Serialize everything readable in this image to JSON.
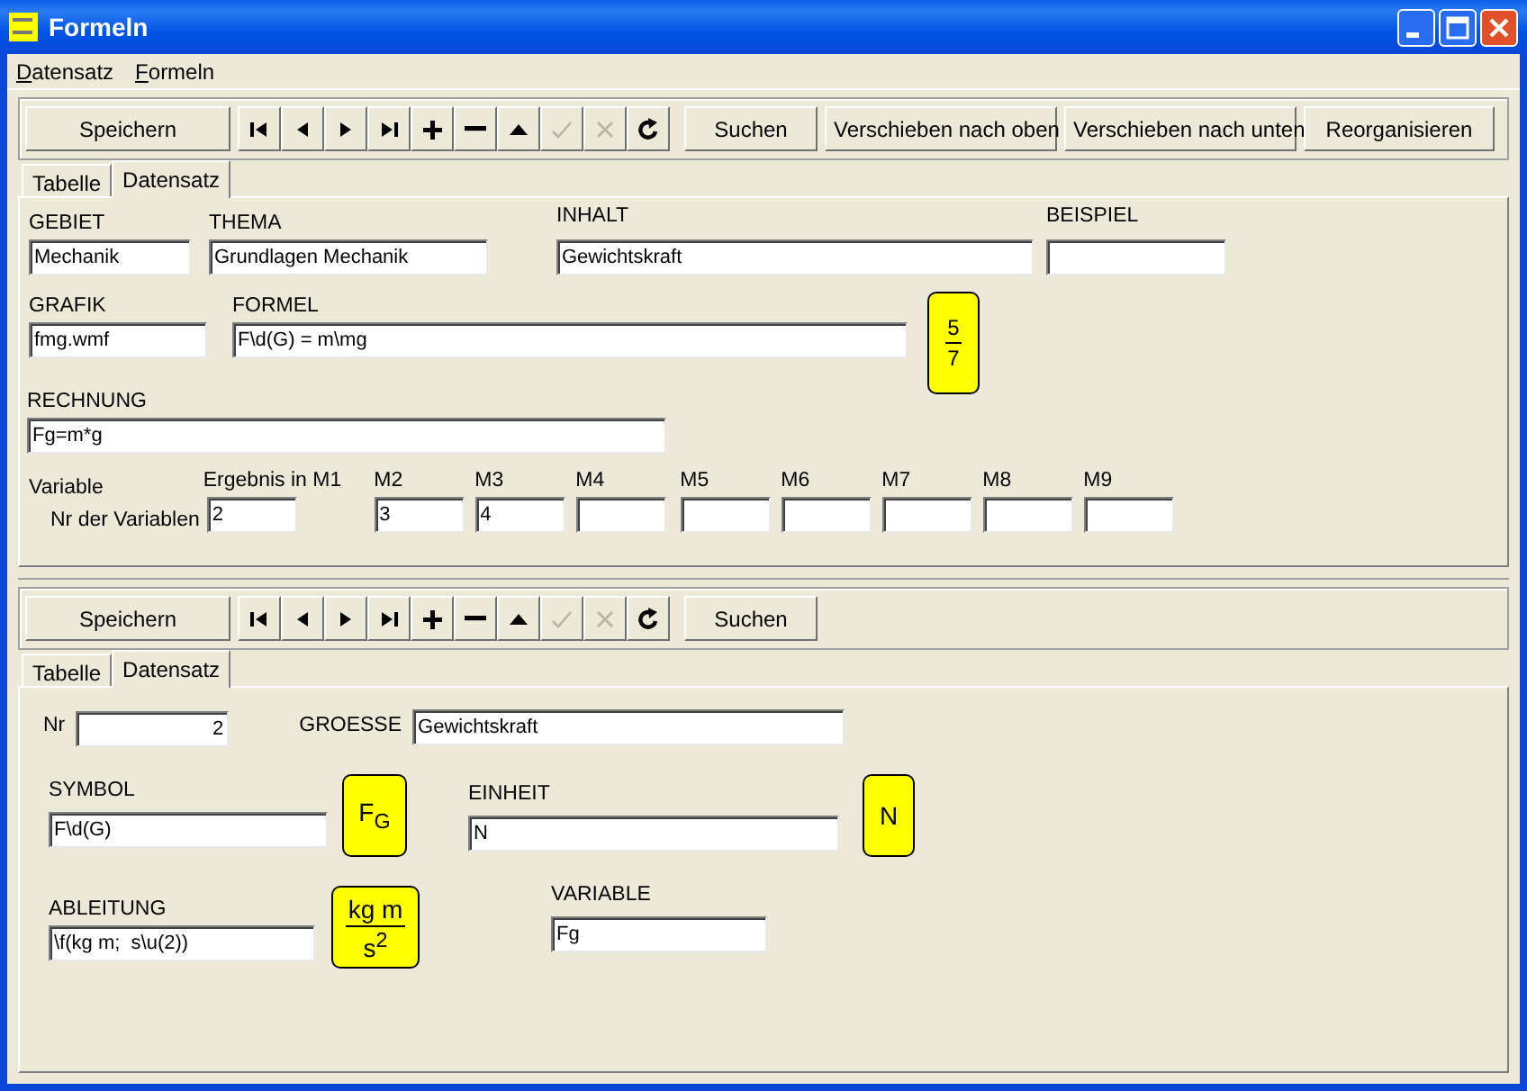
{
  "window": {
    "title": "Formeln"
  },
  "menu": [
    {
      "label": "Datensatz"
    },
    {
      "label": "Formeln"
    }
  ],
  "toolbar": {
    "save": "Speichern",
    "nav": [
      {
        "kind": "first",
        "disabled": false
      },
      {
        "kind": "prior",
        "disabled": false
      },
      {
        "kind": "next",
        "disabled": false
      },
      {
        "kind": "last",
        "disabled": false
      },
      {
        "kind": "insert",
        "disabled": false
      },
      {
        "kind": "delete",
        "disabled": false
      },
      {
        "kind": "edit",
        "disabled": false
      },
      {
        "kind": "post",
        "disabled": true
      },
      {
        "kind": "cancel",
        "disabled": true
      },
      {
        "kind": "refresh",
        "disabled": false
      }
    ],
    "buttons": [
      "Suchen",
      "Verschieben nach oben",
      "Verschieben nach unten",
      "Reorganisieren"
    ]
  },
  "tabs": [
    {
      "label": "Tabelle",
      "selected": false
    },
    {
      "label": "Datensatz",
      "selected": true
    }
  ],
  "formula_form": {
    "gebiet": {
      "label": "GEBIET",
      "value": "Mechanik"
    },
    "thema": {
      "label": "THEMA",
      "value": "Grundlagen Mechanik"
    },
    "inhalt": {
      "label": "INHALT",
      "value": "Gewichtskraft"
    },
    "beispiel": {
      "label": "BEISPIEL"
    },
    "grafik": {
      "label": "GRAFIK",
      "value": "fmg.wmf"
    },
    "formel": {
      "label": "FORMEL",
      "value": "F\\d(G) = m\\mg"
    },
    "preview": {
      "kind": "fraction",
      "numerator": "5",
      "denominator": "7"
    },
    "rechnung": {
      "label": "RECHNUNG",
      "value": "Fg=m*g"
    },
    "variables": {
      "label": "Variable",
      "sublabel": "Nr der Variablen",
      "fields": [
        {
          "label": "Ergebnis in M1",
          "value": "2"
        },
        {
          "label": "M2",
          "value": "3"
        },
        {
          "label": "M3",
          "value": "4"
        },
        {
          "label": "M4"
        },
        {
          "label": "M5"
        },
        {
          "label": "M6"
        },
        {
          "label": "M7"
        },
        {
          "label": "M8"
        },
        {
          "label": "M9"
        }
      ]
    }
  },
  "detail_toolbar": {
    "save": "Speichern",
    "nav": [
      {
        "kind": "first",
        "disabled": false
      },
      {
        "kind": "prior",
        "disabled": false
      },
      {
        "kind": "next",
        "disabled": false
      },
      {
        "kind": "last",
        "disabled": false
      },
      {
        "kind": "insert",
        "disabled": false
      },
      {
        "kind": "delete",
        "disabled": false
      },
      {
        "kind": "edit",
        "disabled": false
      },
      {
        "kind": "post",
        "disabled": true
      },
      {
        "kind": "cancel",
        "disabled": true
      },
      {
        "kind": "refresh",
        "disabled": false
      }
    ],
    "buttons": [
      "Suchen"
    ]
  },
  "detail_tabs": [
    {
      "label": "Tabelle",
      "selected": false
    },
    {
      "label": "Datensatz",
      "selected": true
    }
  ],
  "variable_form": {
    "nr": {
      "label": "Nr",
      "value": "2"
    },
    "groesse": {
      "label": "GROESSE",
      "value": "Gewichtskraft"
    },
    "symbol": {
      "label": "SYMBOL",
      "value": "F\\d(G)"
    },
    "symbol_preview": {
      "kind": "symbol",
      "text": "F$_{G}$"
    },
    "einheit": {
      "label": "EINHEIT",
      "value": "N"
    },
    "einheit_preview": {
      "kind": "symbol",
      "text": "N"
    },
    "ableitung": {
      "label": "ABLEITUNG",
      "value": "\\f(kg m;  s\\u(2))"
    },
    "ableitung_preview": {
      "kind": "fraction",
      "numerator": "kg m",
      "denominator": "s$^{2}$"
    },
    "variable": {
      "label": "VARIABLE",
      "value": "Fg"
    }
  }
}
